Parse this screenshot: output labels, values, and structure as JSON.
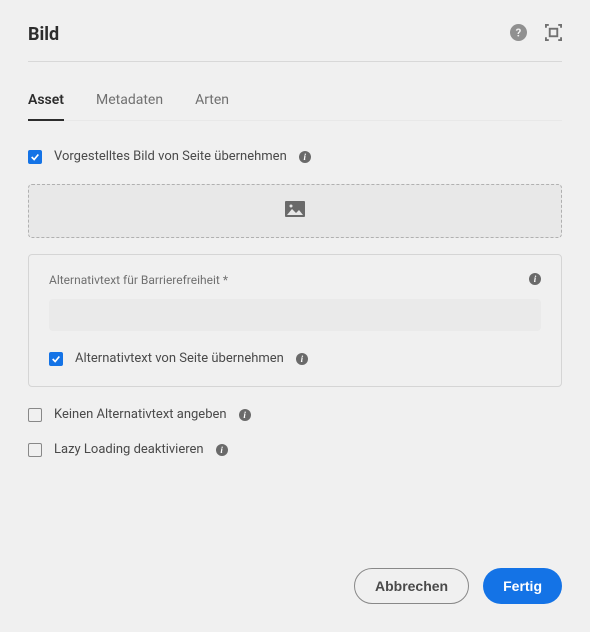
{
  "dialog": {
    "title": "Bild"
  },
  "tabs": [
    {
      "label": "Asset",
      "active": true
    },
    {
      "label": "Metadaten",
      "active": false
    },
    {
      "label": "Arten",
      "active": false
    }
  ],
  "checkboxes": {
    "inheritFeatured": {
      "label": "Vorgestelltes Bild von Seite übernehmen",
      "checked": true
    },
    "inheritAlt": {
      "label": "Alternativtext von Seite übernehmen",
      "checked": true
    },
    "noAlt": {
      "label": "Keinen Alternativtext angeben",
      "checked": false
    },
    "disableLazy": {
      "label": "Lazy Loading deaktivieren",
      "checked": false
    }
  },
  "altField": {
    "label": "Alternativtext für Barrierefreiheit *",
    "value": ""
  },
  "footer": {
    "cancel": "Abbrechen",
    "done": "Fertig"
  }
}
